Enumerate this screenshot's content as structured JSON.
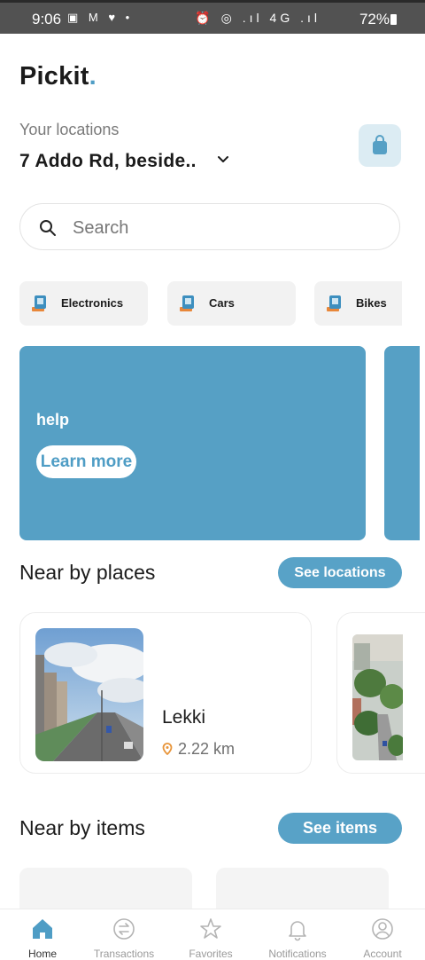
{
  "status_bar": {
    "time": "9:06",
    "left_icons": "▣ M ♥ •",
    "right_icons": "⏰ ◎ .ıl 4G .ıl",
    "battery": "72%"
  },
  "app": {
    "logo": "Pickit",
    "logo_dot": ".",
    "accent": "#4f9dc5"
  },
  "location": {
    "label": "Your locations",
    "value": "7 Addo Rd, beside.."
  },
  "search": {
    "placeholder": "Search"
  },
  "categories": [
    {
      "label": "Electronics"
    },
    {
      "label": "Cars"
    },
    {
      "label": "Bikes"
    }
  ],
  "banner": {
    "title": "help",
    "button": "Learn more",
    "color": "#56a0c5"
  },
  "nearby_places": {
    "title": "Near by places",
    "button": "See locations",
    "items": [
      {
        "name": "Lekki",
        "distance": "2.22 km"
      }
    ]
  },
  "nearby_items": {
    "title": "Near by items",
    "button": "See items"
  },
  "bottom_nav": [
    {
      "icon": "home-icon",
      "label": "Home",
      "active": true
    },
    {
      "icon": "transactions-icon",
      "label": "Transactions",
      "active": false
    },
    {
      "icon": "star-icon",
      "label": "Favorites",
      "active": false
    },
    {
      "icon": "bell-icon",
      "label": "Notifications",
      "active": false
    },
    {
      "icon": "account-icon",
      "label": "Account",
      "active": false
    }
  ]
}
